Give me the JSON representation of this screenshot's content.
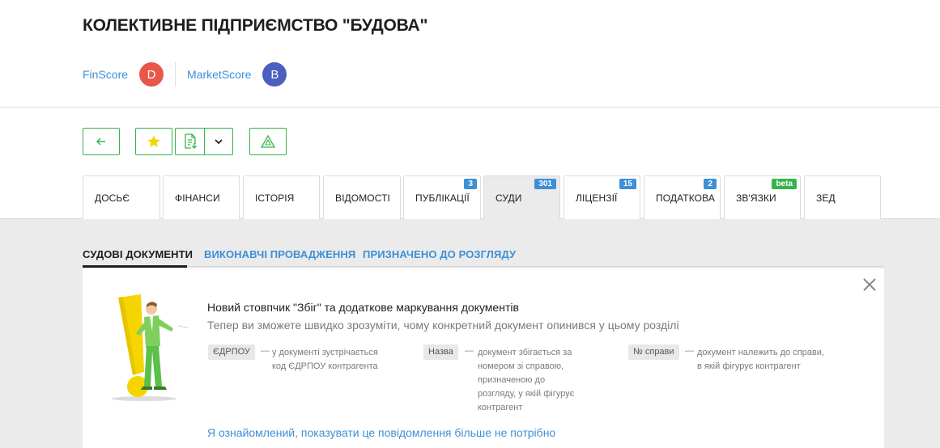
{
  "company": {
    "title": "КОЛЕКТИВНЕ ПІДПРИЄМСТВО \"БУДОВА\""
  },
  "scores": {
    "finscore": {
      "label": "FinScore",
      "grade": "D",
      "color": "#e8574a"
    },
    "marketscore": {
      "label": "MarketScore",
      "grade": "B",
      "color": "#4b5fbf"
    }
  },
  "toolbar": {
    "back_icon": "arrow-left-icon",
    "favorite_icon": "star-icon",
    "export_icon": "document-download-icon",
    "export_menu_icon": "chevron-down-icon",
    "connections_icon": "network-triangle-icon"
  },
  "tabs": [
    {
      "label": "ДОСЬЄ",
      "badge": ""
    },
    {
      "label": "ФІНАНСИ",
      "badge": ""
    },
    {
      "label": "ІСТОРІЯ",
      "badge": ""
    },
    {
      "label": "ВІДОМОСТІ",
      "badge": ""
    },
    {
      "label": "ПУБЛІКАЦІЇ",
      "badge": "3"
    },
    {
      "label": "СУДИ",
      "badge": "301",
      "active": true
    },
    {
      "label": "ЛІЦЕНЗІЇ",
      "badge": "15"
    },
    {
      "label": "ПОДАТКОВА",
      "badge": "2"
    },
    {
      "label": "ЗВ'ЯЗКИ",
      "badge": "beta"
    },
    {
      "label": "ЗЕД",
      "badge": ""
    }
  ],
  "subtabs": [
    {
      "label": "СУДОВІ ДОКУМЕНТИ",
      "active": true
    },
    {
      "label": "ВИКОНАВЧІ ПРОВАДЖЕННЯ",
      "active": false
    },
    {
      "label": "ПРИЗНАЧЕНО ДО РОЗГЛЯДУ",
      "active": false
    }
  ],
  "notice": {
    "title": "Новий стовпчик \"Збіг\" та додаткове маркування документів",
    "subtitle": "Тепер ви зможете швидко зрозуміти, чому конкретний документ опинився у цьому розділі",
    "legend": [
      {
        "tag": "ЄДРПОУ",
        "dash": "—",
        "lines": [
          "у документі зустрічається",
          "код ЄДРПОУ контрагента"
        ]
      },
      {
        "tag": "Назва",
        "dash": "—",
        "lines": [
          "документ збігається за",
          "номером зі справою,",
          "призначеною до",
          "розгляду, у якій фігурує",
          "контрагент"
        ]
      },
      {
        "tag": "№ справи",
        "dash": "—",
        "lines": [
          "документ належить до справи,",
          "в якій фігурує контрагент"
        ]
      }
    ],
    "dismiss": "Я ознайомлений, показувати це повідомлення більше не потрібно",
    "close_icon": "close-icon",
    "illustration": "exclamation-man-illustration"
  },
  "colors": {
    "accent_green": "#35b44a",
    "link_blue": "#3d8fd6",
    "badge_blue": "#3d8fd6",
    "star_yellow": "#f5d400"
  }
}
